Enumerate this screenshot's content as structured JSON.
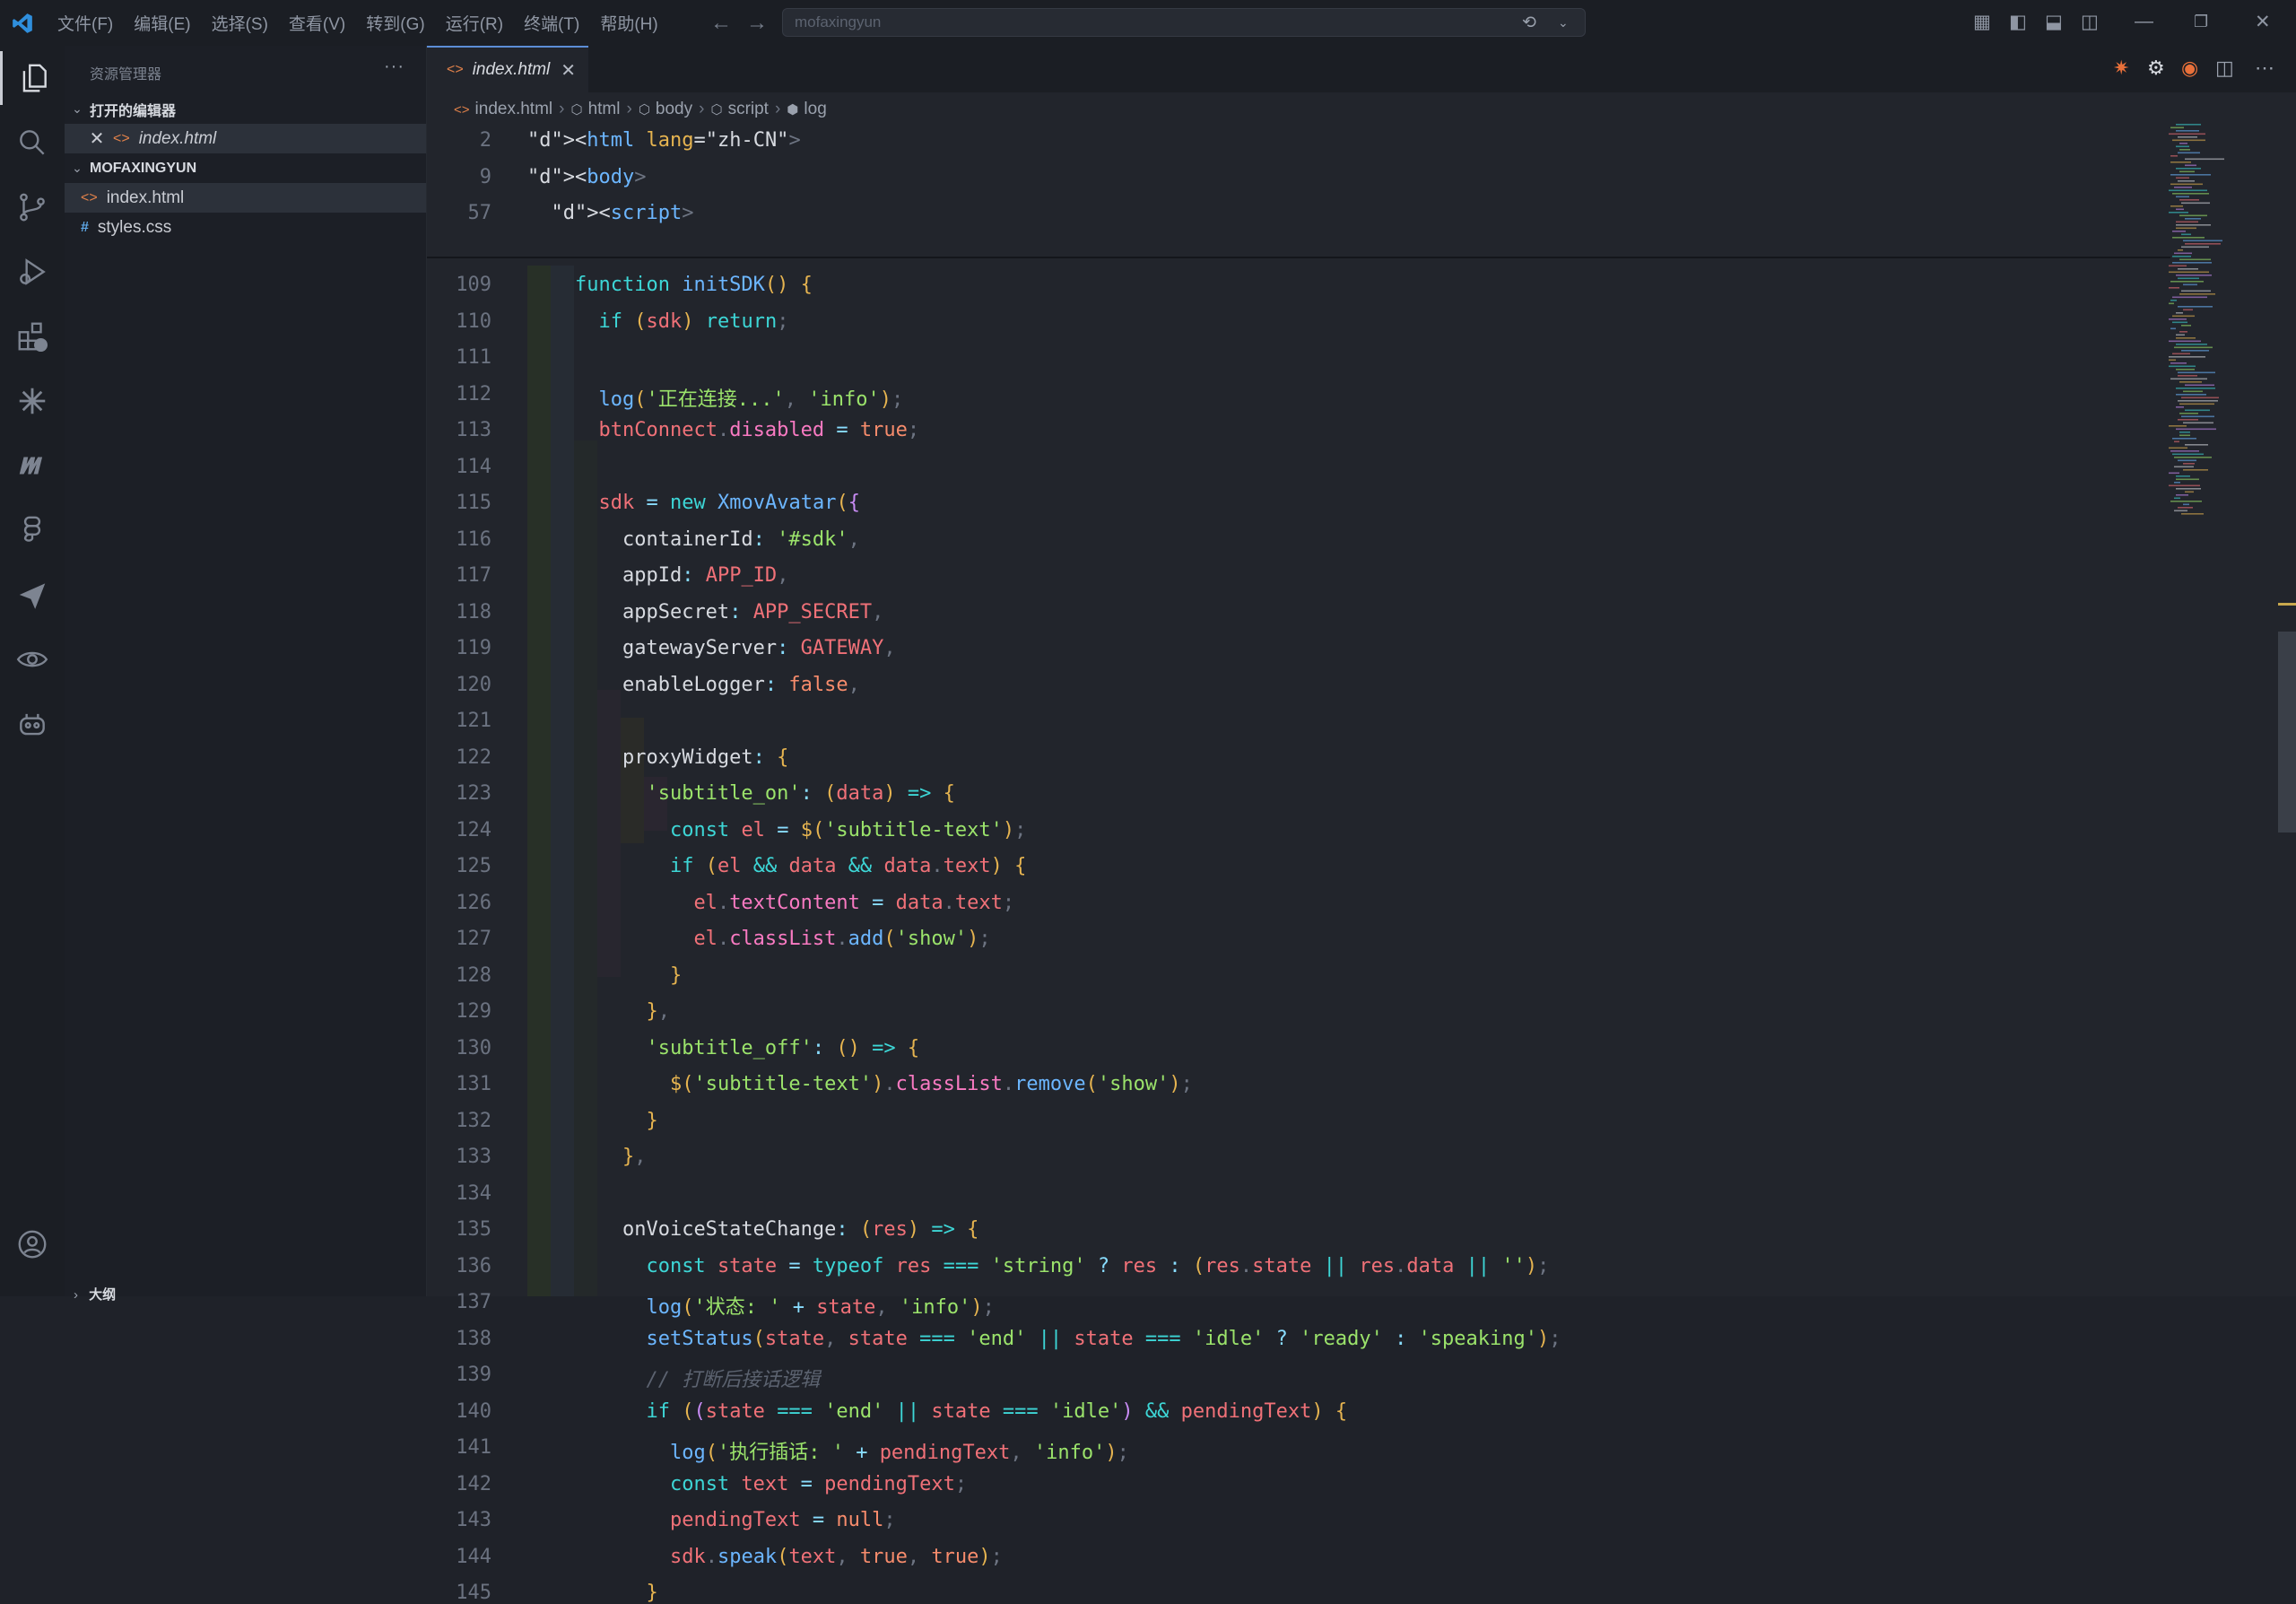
{
  "menu": [
    "文件(F)",
    "编辑(E)",
    "选择(S)",
    "查看(V)",
    "转到(G)",
    "运行(R)",
    "终端(T)",
    "帮助(H)"
  ],
  "search": {
    "text": "mofaxingyun"
  },
  "sidebar": {
    "title": "资源管理器",
    "open_editors_label": "打开的编辑器",
    "open_editor_file": "index.html",
    "project_label": "MOFAXINGYUN",
    "files": [
      "index.html",
      "styles.css"
    ],
    "outline_label": "大纲"
  },
  "tab": {
    "name": "index.html"
  },
  "breadcrumb": [
    "index.html",
    "html",
    "body",
    "script",
    "log"
  ],
  "sticky": [
    {
      "n": "2",
      "code": "<html lang=\"zh-CN\">"
    },
    {
      "n": "9",
      "code": "<body>"
    },
    {
      "n": "57",
      "code": "  <script>"
    }
  ],
  "code_lines": [
    {
      "n": "109",
      "code": "    function initSDK() {"
    },
    {
      "n": "110",
      "code": "      if (sdk) return;"
    },
    {
      "n": "111",
      "code": ""
    },
    {
      "n": "112",
      "code": "      log('正在连接...', 'info');"
    },
    {
      "n": "113",
      "code": "      btnConnect.disabled = true;"
    },
    {
      "n": "114",
      "code": ""
    },
    {
      "n": "115",
      "code": "      sdk = new XmovAvatar({"
    },
    {
      "n": "116",
      "code": "        containerId: '#sdk',"
    },
    {
      "n": "117",
      "code": "        appId: APP_ID,"
    },
    {
      "n": "118",
      "code": "        appSecret: APP_SECRET,"
    },
    {
      "n": "119",
      "code": "        gatewayServer: GATEWAY,"
    },
    {
      "n": "120",
      "code": "        enableLogger: false,"
    },
    {
      "n": "121",
      "code": ""
    },
    {
      "n": "122",
      "code": "        proxyWidget: {"
    },
    {
      "n": "123",
      "code": "          'subtitle_on': (data) => {"
    },
    {
      "n": "124",
      "code": "            const el = $('subtitle-text');"
    },
    {
      "n": "125",
      "code": "            if (el && data && data.text) {"
    },
    {
      "n": "126",
      "code": "              el.textContent = data.text;"
    },
    {
      "n": "127",
      "code": "              el.classList.add('show');"
    },
    {
      "n": "128",
      "code": "            }"
    },
    {
      "n": "129",
      "code": "          },"
    },
    {
      "n": "130",
      "code": "          'subtitle_off': () => {"
    },
    {
      "n": "131",
      "code": "            $('subtitle-text').classList.remove('show');"
    },
    {
      "n": "132",
      "code": "          }"
    },
    {
      "n": "133",
      "code": "        },"
    },
    {
      "n": "134",
      "code": ""
    },
    {
      "n": "135",
      "code": "        onVoiceStateChange: (res) => {"
    },
    {
      "n": "136",
      "code": "          const state = typeof res === 'string' ? res : (res.state || res.data || '');"
    },
    {
      "n": "137",
      "code": "          log('状态: ' + state, 'info');"
    },
    {
      "n": "138",
      "code": "          setStatus(state, state === 'end' || state === 'idle' ? 'ready' : 'speaking');"
    },
    {
      "n": "139",
      "code": "          // 打断后接话逻辑"
    },
    {
      "n": "140",
      "code": "          if ((state === 'end' || state === 'idle') && pendingText) {"
    },
    {
      "n": "141",
      "code": "            log('执行插话: ' + pendingText, 'info');"
    },
    {
      "n": "142",
      "code": "            const text = pendingText;"
    },
    {
      "n": "143",
      "code": "            pendingText = null;"
    },
    {
      "n": "144",
      "code": "            sdk.speak(text, true, true);"
    },
    {
      "n": "145",
      "code": "          }"
    }
  ]
}
